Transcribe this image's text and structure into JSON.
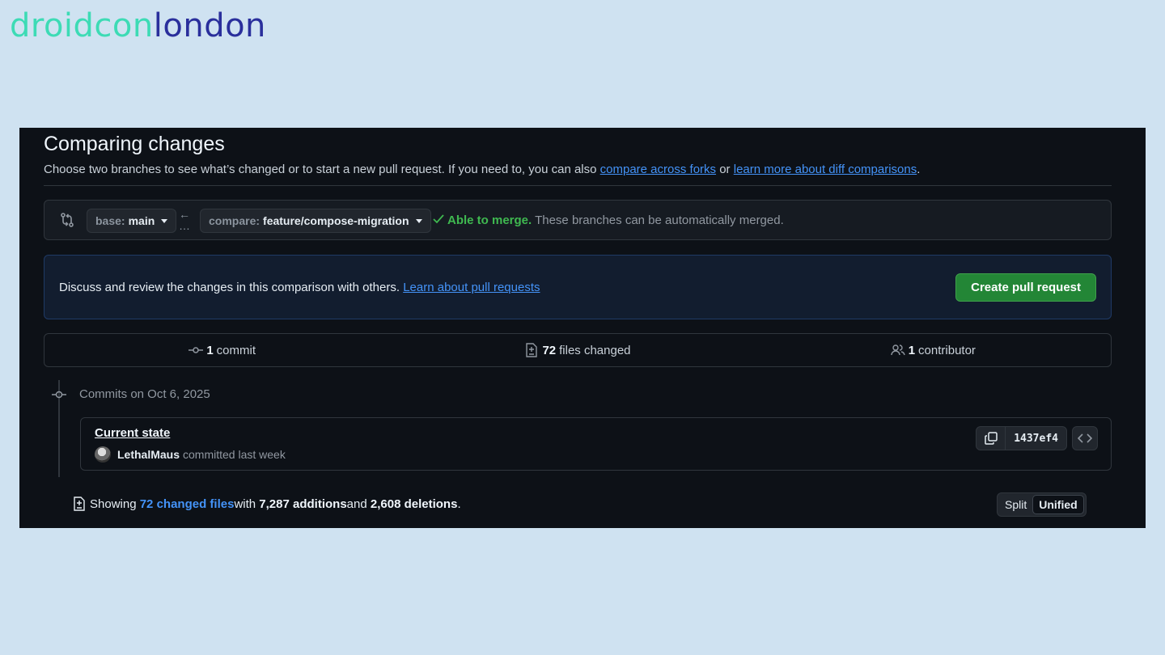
{
  "logo": {
    "part1": "droidcon",
    "part2": "london"
  },
  "header": {
    "title": "Comparing changes",
    "intro_text": "Choose two branches to see what’s changed or to start a new pull request. If you need to, you can also ",
    "link_forks": "compare across forks",
    "or_text": " or ",
    "link_diff": "learn more about diff comparisons",
    "period": "."
  },
  "compare_bar": {
    "base_prefix": "base:",
    "base_value": "main",
    "compare_prefix": "compare:",
    "compare_value": "feature/compose-migration",
    "merge_ok": "Able to merge.",
    "merge_msg": " These branches can be automatically merged."
  },
  "discuss": {
    "text": "Discuss and review the changes in this comparison with others. ",
    "link": "Learn about pull requests",
    "button": "Create pull request"
  },
  "stats": {
    "commits_count": "1",
    "commits_label": "commit",
    "files_count": "72",
    "files_label": "files changed",
    "contributors_count": "1",
    "contributors_label": "contributor"
  },
  "commits": {
    "date_header": "Commits on Oct 6, 2025",
    "items": [
      {
        "title": "Current state",
        "author": "LethalMaus",
        "time": "committed last week",
        "sha": "1437ef4"
      }
    ]
  },
  "summary": {
    "prefix": "Showing ",
    "files_link": "72 changed files",
    "with": " with ",
    "additions": "7,287 additions",
    "and": " and ",
    "deletions": "2,608 deletions",
    "period": "."
  },
  "view_toggle": {
    "split": "Split",
    "unified": "Unified",
    "selected": "Unified"
  },
  "colors": {
    "background": "#cfe2f1",
    "panel": "#0d1117",
    "accent_green": "#238636",
    "link_blue": "#4493f8",
    "merge_green": "#3fb950"
  }
}
